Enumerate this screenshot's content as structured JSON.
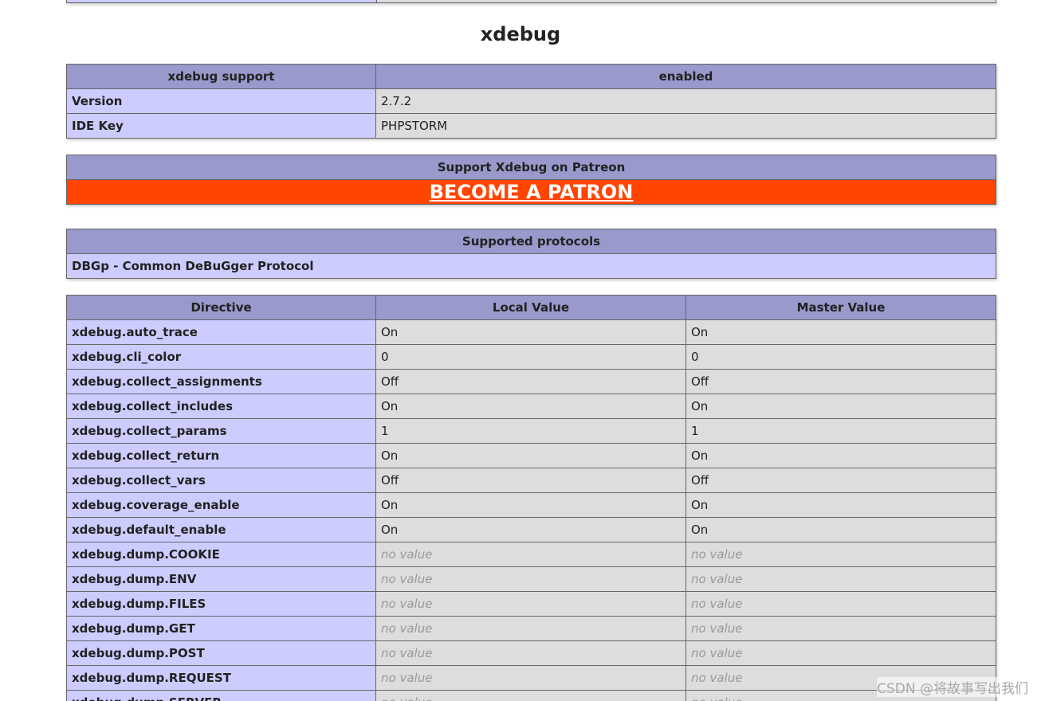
{
  "title": "xdebug",
  "support_table": {
    "header": [
      "xdebug support",
      "enabled"
    ],
    "rows": [
      {
        "label": "Version",
        "value": "2.7.2"
      },
      {
        "label": "IDE Key",
        "value": "PHPSTORM"
      }
    ]
  },
  "patreon": {
    "header": "Support Xdebug on Patreon",
    "link_label": "BECOME A PATRON"
  },
  "protocols": {
    "header": "Supported protocols",
    "row": "DBGp - Common DeBuGger Protocol"
  },
  "directives": {
    "headers": [
      "Directive",
      "Local Value",
      "Master Value"
    ],
    "no_value_label": "no value",
    "rows": [
      {
        "name": "xdebug.auto_trace",
        "local": "On",
        "master": "On"
      },
      {
        "name": "xdebug.cli_color",
        "local": "0",
        "master": "0"
      },
      {
        "name": "xdebug.collect_assignments",
        "local": "Off",
        "master": "Off"
      },
      {
        "name": "xdebug.collect_includes",
        "local": "On",
        "master": "On"
      },
      {
        "name": "xdebug.collect_params",
        "local": "1",
        "master": "1"
      },
      {
        "name": "xdebug.collect_return",
        "local": "On",
        "master": "On"
      },
      {
        "name": "xdebug.collect_vars",
        "local": "Off",
        "master": "Off"
      },
      {
        "name": "xdebug.coverage_enable",
        "local": "On",
        "master": "On"
      },
      {
        "name": "xdebug.default_enable",
        "local": "On",
        "master": "On"
      },
      {
        "name": "xdebug.dump.COOKIE",
        "local": "no value",
        "master": "no value"
      },
      {
        "name": "xdebug.dump.ENV",
        "local": "no value",
        "master": "no value"
      },
      {
        "name": "xdebug.dump.FILES",
        "local": "no value",
        "master": "no value"
      },
      {
        "name": "xdebug.dump.GET",
        "local": "no value",
        "master": "no value"
      },
      {
        "name": "xdebug.dump.POST",
        "local": "no value",
        "master": "no value"
      },
      {
        "name": "xdebug.dump.REQUEST",
        "local": "no value",
        "master": "no value"
      },
      {
        "name": "xdebug.dump.SERVER",
        "local": "no value",
        "master": "no value"
      }
    ]
  },
  "watermark": "CSDN @将故事写出我们",
  "colors": {
    "header": "#9999cc",
    "label_cell": "#ccccff",
    "value_cell": "#dddddd",
    "patron": "#ff4500",
    "no_value": "#999999"
  }
}
